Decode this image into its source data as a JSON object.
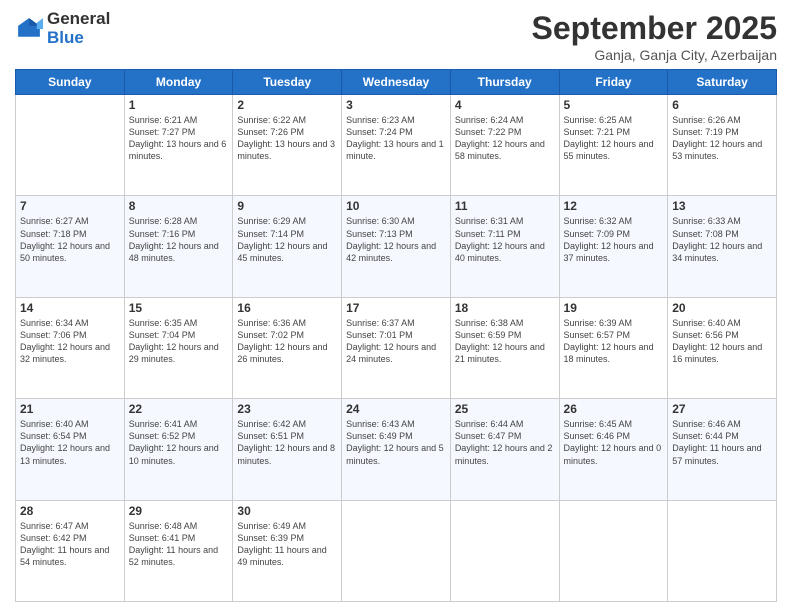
{
  "logo": {
    "general": "General",
    "blue": "Blue"
  },
  "title": {
    "month": "September 2025",
    "location": "Ganja, Ganja City, Azerbaijan"
  },
  "days_header": [
    "Sunday",
    "Monday",
    "Tuesday",
    "Wednesday",
    "Thursday",
    "Friday",
    "Saturday"
  ],
  "weeks": [
    [
      {
        "day": "",
        "sunrise": "",
        "sunset": "",
        "daylight": "",
        "empty": true
      },
      {
        "day": "1",
        "sunrise": "Sunrise: 6:21 AM",
        "sunset": "Sunset: 7:27 PM",
        "daylight": "Daylight: 13 hours and 6 minutes."
      },
      {
        "day": "2",
        "sunrise": "Sunrise: 6:22 AM",
        "sunset": "Sunset: 7:26 PM",
        "daylight": "Daylight: 13 hours and 3 minutes."
      },
      {
        "day": "3",
        "sunrise": "Sunrise: 6:23 AM",
        "sunset": "Sunset: 7:24 PM",
        "daylight": "Daylight: 13 hours and 1 minute."
      },
      {
        "day": "4",
        "sunrise": "Sunrise: 6:24 AM",
        "sunset": "Sunset: 7:22 PM",
        "daylight": "Daylight: 12 hours and 58 minutes."
      },
      {
        "day": "5",
        "sunrise": "Sunrise: 6:25 AM",
        "sunset": "Sunset: 7:21 PM",
        "daylight": "Daylight: 12 hours and 55 minutes."
      },
      {
        "day": "6",
        "sunrise": "Sunrise: 6:26 AM",
        "sunset": "Sunset: 7:19 PM",
        "daylight": "Daylight: 12 hours and 53 minutes."
      }
    ],
    [
      {
        "day": "7",
        "sunrise": "Sunrise: 6:27 AM",
        "sunset": "Sunset: 7:18 PM",
        "daylight": "Daylight: 12 hours and 50 minutes."
      },
      {
        "day": "8",
        "sunrise": "Sunrise: 6:28 AM",
        "sunset": "Sunset: 7:16 PM",
        "daylight": "Daylight: 12 hours and 48 minutes."
      },
      {
        "day": "9",
        "sunrise": "Sunrise: 6:29 AM",
        "sunset": "Sunset: 7:14 PM",
        "daylight": "Daylight: 12 hours and 45 minutes."
      },
      {
        "day": "10",
        "sunrise": "Sunrise: 6:30 AM",
        "sunset": "Sunset: 7:13 PM",
        "daylight": "Daylight: 12 hours and 42 minutes."
      },
      {
        "day": "11",
        "sunrise": "Sunrise: 6:31 AM",
        "sunset": "Sunset: 7:11 PM",
        "daylight": "Daylight: 12 hours and 40 minutes."
      },
      {
        "day": "12",
        "sunrise": "Sunrise: 6:32 AM",
        "sunset": "Sunset: 7:09 PM",
        "daylight": "Daylight: 12 hours and 37 minutes."
      },
      {
        "day": "13",
        "sunrise": "Sunrise: 6:33 AM",
        "sunset": "Sunset: 7:08 PM",
        "daylight": "Daylight: 12 hours and 34 minutes."
      }
    ],
    [
      {
        "day": "14",
        "sunrise": "Sunrise: 6:34 AM",
        "sunset": "Sunset: 7:06 PM",
        "daylight": "Daylight: 12 hours and 32 minutes."
      },
      {
        "day": "15",
        "sunrise": "Sunrise: 6:35 AM",
        "sunset": "Sunset: 7:04 PM",
        "daylight": "Daylight: 12 hours and 29 minutes."
      },
      {
        "day": "16",
        "sunrise": "Sunrise: 6:36 AM",
        "sunset": "Sunset: 7:02 PM",
        "daylight": "Daylight: 12 hours and 26 minutes."
      },
      {
        "day": "17",
        "sunrise": "Sunrise: 6:37 AM",
        "sunset": "Sunset: 7:01 PM",
        "daylight": "Daylight: 12 hours and 24 minutes."
      },
      {
        "day": "18",
        "sunrise": "Sunrise: 6:38 AM",
        "sunset": "Sunset: 6:59 PM",
        "daylight": "Daylight: 12 hours and 21 minutes."
      },
      {
        "day": "19",
        "sunrise": "Sunrise: 6:39 AM",
        "sunset": "Sunset: 6:57 PM",
        "daylight": "Daylight: 12 hours and 18 minutes."
      },
      {
        "day": "20",
        "sunrise": "Sunrise: 6:40 AM",
        "sunset": "Sunset: 6:56 PM",
        "daylight": "Daylight: 12 hours and 16 minutes."
      }
    ],
    [
      {
        "day": "21",
        "sunrise": "Sunrise: 6:40 AM",
        "sunset": "Sunset: 6:54 PM",
        "daylight": "Daylight: 12 hours and 13 minutes."
      },
      {
        "day": "22",
        "sunrise": "Sunrise: 6:41 AM",
        "sunset": "Sunset: 6:52 PM",
        "daylight": "Daylight: 12 hours and 10 minutes."
      },
      {
        "day": "23",
        "sunrise": "Sunrise: 6:42 AM",
        "sunset": "Sunset: 6:51 PM",
        "daylight": "Daylight: 12 hours and 8 minutes."
      },
      {
        "day": "24",
        "sunrise": "Sunrise: 6:43 AM",
        "sunset": "Sunset: 6:49 PM",
        "daylight": "Daylight: 12 hours and 5 minutes."
      },
      {
        "day": "25",
        "sunrise": "Sunrise: 6:44 AM",
        "sunset": "Sunset: 6:47 PM",
        "daylight": "Daylight: 12 hours and 2 minutes."
      },
      {
        "day": "26",
        "sunrise": "Sunrise: 6:45 AM",
        "sunset": "Sunset: 6:46 PM",
        "daylight": "Daylight: 12 hours and 0 minutes."
      },
      {
        "day": "27",
        "sunrise": "Sunrise: 6:46 AM",
        "sunset": "Sunset: 6:44 PM",
        "daylight": "Daylight: 11 hours and 57 minutes."
      }
    ],
    [
      {
        "day": "28",
        "sunrise": "Sunrise: 6:47 AM",
        "sunset": "Sunset: 6:42 PM",
        "daylight": "Daylight: 11 hours and 54 minutes."
      },
      {
        "day": "29",
        "sunrise": "Sunrise: 6:48 AM",
        "sunset": "Sunset: 6:41 PM",
        "daylight": "Daylight: 11 hours and 52 minutes."
      },
      {
        "day": "30",
        "sunrise": "Sunrise: 6:49 AM",
        "sunset": "Sunset: 6:39 PM",
        "daylight": "Daylight: 11 hours and 49 minutes."
      },
      {
        "day": "",
        "sunrise": "",
        "sunset": "",
        "daylight": "",
        "empty": true
      },
      {
        "day": "",
        "sunrise": "",
        "sunset": "",
        "daylight": "",
        "empty": true
      },
      {
        "day": "",
        "sunrise": "",
        "sunset": "",
        "daylight": "",
        "empty": true
      },
      {
        "day": "",
        "sunrise": "",
        "sunset": "",
        "daylight": "",
        "empty": true
      }
    ]
  ]
}
